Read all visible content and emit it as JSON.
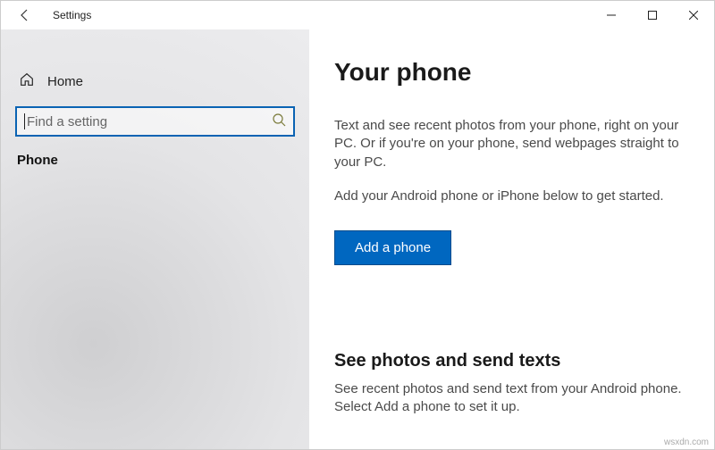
{
  "titlebar": {
    "app_title": "Settings"
  },
  "sidebar": {
    "home_label": "Home",
    "search_placeholder": "Find a setting",
    "current_section": "Phone"
  },
  "content": {
    "heading": "Your phone",
    "intro": "Text and see recent photos from your phone, right on your PC. Or if you're on your phone, send webpages straight to your PC.",
    "get_started": "Add your Android phone or iPhone below to get started.",
    "cta_label": "Add a phone",
    "section2_heading": "See photos and send texts",
    "section2_body": "See recent photos and send text from your Android phone. Select Add a phone to set it up."
  },
  "watermark": "wsxdn.com"
}
